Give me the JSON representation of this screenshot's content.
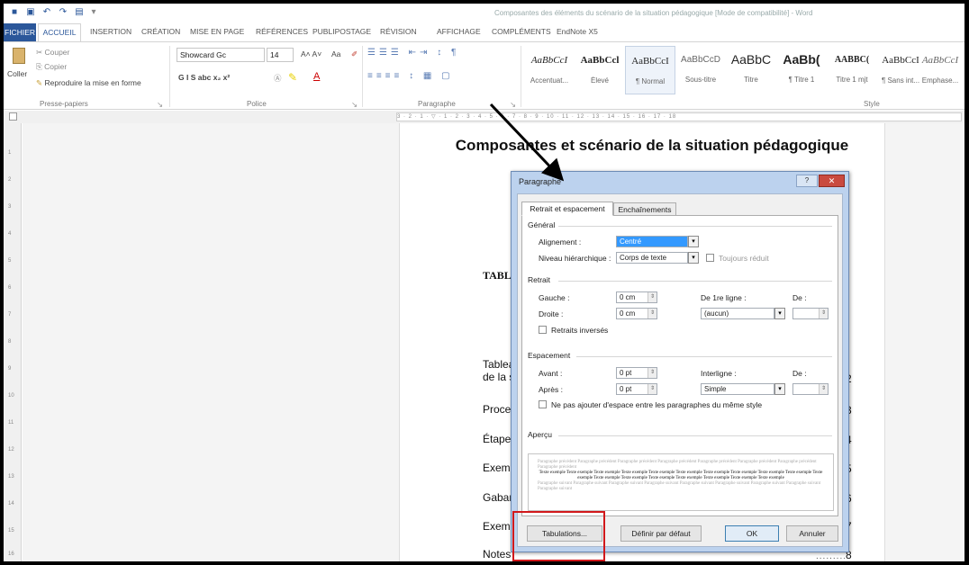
{
  "title_bar": {
    "document_title": "Composantes des éléments du scénario de la situation pédagogique [Mode de compatibilité] - Word"
  },
  "tabs": [
    "FICHIER",
    "ACCUEIL",
    "INSERTION",
    "CRÉATION",
    "MISE EN PAGE",
    "RÉFÉRENCES",
    "PUBLIPOSTAGE",
    "RÉVISION",
    "AFFICHAGE",
    "COMPLÉMENTS",
    "EndNote X5"
  ],
  "ribbon": {
    "clipboard": {
      "paste": "Coller",
      "cut": "Couper",
      "copy": "Copier",
      "format_painter": "Reproduire la mise en forme",
      "group": "Presse-papiers"
    },
    "font": {
      "font_name": "Showcard Gc",
      "font_size": "14",
      "grow_shrink": "A˄ A˅",
      "case": "Aa",
      "format_row": "G  I  S  abc  x₂  x²",
      "group": "Police"
    },
    "paragraph": {
      "group": "Paragraphe"
    },
    "styles": {
      "group": "Style",
      "items": [
        {
          "sample": "AaBbCcI",
          "name": "Accentuat..."
        },
        {
          "sample": "AaBbCcl",
          "name": "Élevé"
        },
        {
          "sample": "AaBbCcI",
          "name": "¶ Normal"
        },
        {
          "sample": "AaBbCcD",
          "name": "Sous-titre"
        },
        {
          "sample": "AaBbC",
          "name": "Titre"
        },
        {
          "sample": "AaBb(",
          "name": "¶ Titre 1"
        },
        {
          "sample": "AABBC(",
          "name": "Titre 1 mjt"
        },
        {
          "sample": "AaBbCcI",
          "name": "¶ Sans int..."
        },
        {
          "sample": "AaBbCcI",
          "name": "Emphase..."
        }
      ]
    }
  },
  "ruler": {
    "marks": "3 · 2 · 1 · ▽ · 1 · 2 · 3 · 4 · 5 · 6 · 7 · 8 · 9 · 10 · 11 · 12 · 13 · 14 · 15 · 16 · 17 · 18",
    "vertical": [
      "1",
      "2",
      "3",
      "4",
      "5",
      "6",
      "7",
      "8",
      "9",
      "10",
      "11",
      "12",
      "13",
      "14",
      "15",
      "16"
    ]
  },
  "document": {
    "heading": "Composantes et scénario de la situation pédagogique",
    "tabl_label": "TABL",
    "toc": [
      {
        "text": "Tablea",
        "text2": "de la s",
        "page": "2"
      },
      {
        "text": "Proce",
        "page": "3"
      },
      {
        "text": "Étape",
        "page": "4"
      },
      {
        "text": "Exem",
        "page": "5"
      },
      {
        "text": "Gabar",
        "page": "6"
      },
      {
        "text": "Exem",
        "page": "7"
      },
      {
        "text": "Notes",
        "page": "8"
      }
    ]
  },
  "dialog": {
    "title": "Paragraphe",
    "help": "?",
    "close": "✕",
    "tabs": [
      "Retrait et espacement",
      "Enchaînements"
    ],
    "general": {
      "section": "Général",
      "alignment_label": "Alignement :",
      "alignment_value": "Centré",
      "outline_label": "Niveau hiérarchique :",
      "outline_value": "Corps de texte",
      "collapsed_label": "Toujours réduit"
    },
    "indent": {
      "section": "Retrait",
      "left_label": "Gauche :",
      "left_value": "0 cm",
      "right_label": "Droite :",
      "right_value": "0 cm",
      "first_line_label": "De 1re ligne :",
      "first_line_value": "(aucun)",
      "by_label": "De :",
      "mirror_label": "Retraits inversés"
    },
    "spacing": {
      "section": "Espacement",
      "before_label": "Avant :",
      "before_value": "0 pt",
      "after_label": "Après :",
      "after_value": "0 pt",
      "line_label": "Interligne :",
      "line_value": "Simple",
      "at_label": "De :",
      "no_space_label": "Ne pas ajouter d'espace entre les paragraphes du même style"
    },
    "preview": {
      "section": "Aperçu",
      "prev_text": "Paragraphe précédent Paragraphe précédent Paragraphe précédent Paragraphe précédent Paragraphe précédent Paragraphe précédent Paragraphe précédent Paragraphe précédent",
      "sample_text": "Texte exemple Texte exemple Texte exemple Texte exemple Texte exemple Texte exemple Texte exemple Texte exemple Texte exemple Texte exemple Texte exemple Texte exemple Texte exemple Texte exemple Texte exemple Texte exemple Texte exemple Texte exemple",
      "next_text": "Paragraphe suivant Paragraphe suivant Paragraphe suivant Paragraphe suivant Paragraphe suivant Paragraphe suivant Paragraphe suivant Paragraphe suivant Paragraphe suivant"
    },
    "buttons": {
      "tabs": "Tabulations...",
      "default": "Définir par défaut",
      "ok": "OK",
      "cancel": "Annuler"
    }
  },
  "colors": {
    "accent": "#2b579a",
    "annotation_red": "#d1181b",
    "selection": "#3399ff"
  }
}
